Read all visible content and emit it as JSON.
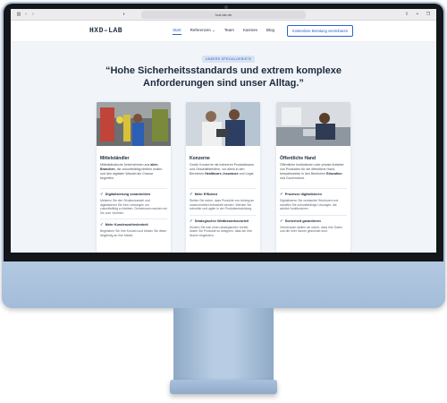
{
  "browser": {
    "url": "hxd-lab.de",
    "icons": [
      "sidebar-icon",
      "back-icon",
      "forward-icon",
      "shield-icon",
      "share-icon",
      "new-tab-icon",
      "tabs-icon"
    ]
  },
  "nav": {
    "logo": "HXD–LAB",
    "items": [
      {
        "label": "Start",
        "active": true
      },
      {
        "label": "Referenzen ⌄",
        "active": false
      },
      {
        "label": "Team",
        "active": false
      },
      {
        "label": "Karriere",
        "active": false
      },
      {
        "label": "Blog",
        "active": false
      }
    ],
    "cta": "Kostenlose Beratung vereinbaren"
  },
  "hero": {
    "badge": "UNSERE SPEZIALGEBIETE",
    "headline": "“Hohe Sicherheitsstandards und extrem komplexe Anforderungen sind unser Alltag.”"
  },
  "cards": [
    {
      "title": "Mittelständler",
      "desc_pre": "Mittelständische Unternehmen aus ",
      "desc_bold": "allen Branchen",
      "desc_post": ", die zukunftsfähig bleiben wollen und den digitalen Wandel als Chance begreifen.",
      "features": [
        {
          "title": "Digitalisierung vorantreiben",
          "text": "Meistern Sie den Strukturwandel und digitalisieren Sie Ihre Leistungen um zukunftsfähig zu bleiben. Gemeinsam machen wir Sie zum Vorreiter."
        },
        {
          "title": "Mehr Kundenzufriedenheit",
          "text": "Begeistern Sie Ihre Kunden und binden Sie diese langfristig an Ihre Marke."
        }
      ]
    },
    {
      "title": "Konzerne",
      "desc_pre": "Große Konzerne mit mehreren Produktteams und Geschäftsfeldern, vor allem in den Bereichen ",
      "desc_bold": "Healthcare, Insurance",
      "desc_post": " und Legal.",
      "features": [
        {
          "title": "Mehr Effizienz",
          "text": "Stellen Sie sicher, dass Produkte von Anfang an nutzerzentriert entwickelt werden. Werden Sie schneller und agiler in der Produktentwicklung."
        },
        {
          "title": "Strategischer Wettbewerbsvorteil",
          "text": "Sichern Sie sich einen strategischen Vorteil, indem Sie Produkte so designen, dass sie Ihre Nutzer begeistern."
        }
      ]
    },
    {
      "title": "Öffentliche Hand",
      "desc_pre": "Öffentliche Institutionen oder private Anbieter von Produkten für die öffentliche Hand, beispielsweise in den Bereichen ",
      "desc_bold": "Education",
      "desc_post": " und Government.",
      "features": [
        {
          "title": "Prozesse digitalisieren",
          "text": "Digitalisieren Sie verstaubte Strukturen und schaffen Sie zukunftsfähige Lösungen, die wirklich funktionieren."
        },
        {
          "title": "Sicherheit garantieren",
          "text": "Gemeinsam stellen wir sicher, dass Ihre Daten und die Ihrer Nutzer geschützt sind."
        }
      ]
    }
  ],
  "colors": {
    "accent": "#2c62c9",
    "page_bg": "#f1f5fa",
    "monitor": "#a9c1dc"
  }
}
